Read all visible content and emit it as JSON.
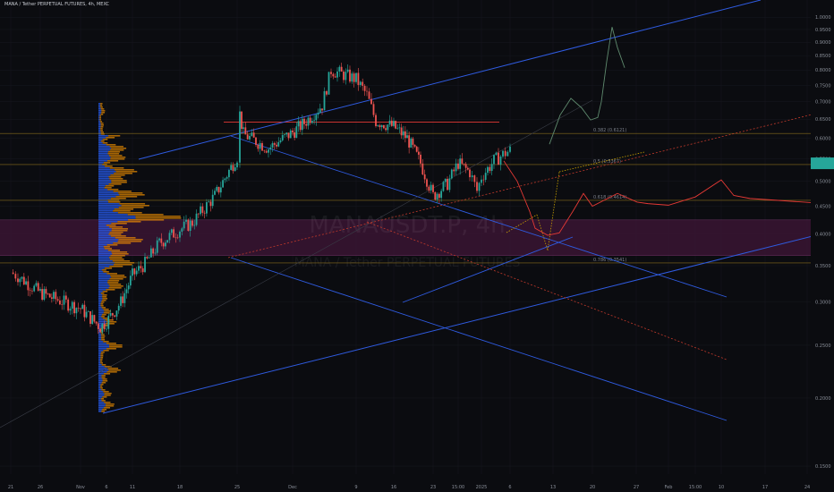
{
  "header": {
    "title": "MANA / Tether PERPETUAL FUTURES, 4h, MEXC"
  },
  "watermark": {
    "symbol": "MANAUSDT.P, 4h",
    "subtitle": "MANA / Tether PERPETUAL FUTURES"
  },
  "colors": {
    "background": "#0b0c10",
    "up": "#26a69a",
    "down": "#ef5350",
    "channel": "#2f5be0",
    "projection": "#e53935",
    "fib": "#9e7d1f",
    "zone": "#3a1533",
    "volume_up": "#2962ff",
    "volume_down": "#ff9800"
  },
  "chart_data": {
    "type": "candlestick",
    "timeframe": "4h",
    "y_axis": {
      "scale": "log",
      "range": [
        0.145,
        1.06
      ],
      "ticks": [
        "1.0000",
        "0.9500",
        "0.9000",
        "0.8500",
        "0.8000",
        "0.7500",
        "0.7000",
        "0.6500",
        "0.6000",
        "0.5500",
        "0.5000",
        "0.4500",
        "0.4000",
        "0.3500",
        "0.3000",
        "0.2500",
        "0.2000",
        "0.1500"
      ],
      "current_price_marker": 0.5385
    },
    "x_axis": {
      "ticks": [
        "21",
        "26",
        "Nov",
        "6",
        "11",
        "18",
        "25",
        "Dec",
        "9",
        "16",
        "23",
        "15:00",
        "2025",
        "6",
        "13",
        "20",
        "27",
        "Feb",
        "15:00",
        "10",
        "17",
        "24"
      ]
    },
    "fib_levels": [
      {
        "ratio": "0.382",
        "price": 0.6121,
        "label": "0.382 (0.6121)"
      },
      {
        "ratio": "0.5",
        "price": 0.5367,
        "label": "0.5 (0.5367)"
      },
      {
        "ratio": "0.618",
        "price": 0.4614,
        "label": "0.618 (0.4614)"
      },
      {
        "ratio": "0.786",
        "price": 0.3541,
        "label": "0.786 (0.3541)"
      }
    ],
    "horizontal_levels": [
      {
        "price": 0.642,
        "role": "resistance"
      }
    ],
    "demand_zone": [
      0.3655,
      0.4245
    ],
    "price_path": [
      [
        "21",
        0.34
      ],
      [
        "23",
        0.335
      ],
      [
        "26",
        0.312
      ],
      [
        "29",
        0.305
      ],
      [
        "Nov",
        0.292
      ],
      [
        "4",
        0.27
      ],
      [
        "6",
        0.276
      ],
      [
        "8",
        0.3
      ],
      [
        "11",
        0.336
      ],
      [
        "14",
        0.353
      ],
      [
        "16",
        0.385
      ],
      [
        "18",
        0.408
      ],
      [
        "20",
        0.42
      ],
      [
        "22",
        0.47
      ],
      [
        "25",
        0.555
      ],
      [
        "26",
        0.665
      ],
      [
        "27",
        0.61
      ],
      [
        "30",
        0.575
      ],
      [
        "Dec",
        0.615
      ],
      [
        "3",
        0.64
      ],
      [
        "5",
        0.69
      ],
      [
        "7",
        0.8
      ],
      [
        "9",
        0.77
      ],
      [
        "11",
        0.72
      ],
      [
        "12",
        0.645
      ],
      [
        "14",
        0.63
      ],
      [
        "16",
        0.6
      ],
      [
        "18",
        0.54
      ],
      [
        "20",
        0.47
      ],
      [
        "23",
        0.495
      ],
      [
        "15:00",
        0.54
      ],
      [
        "26",
        0.52
      ],
      [
        "28",
        0.48
      ],
      [
        "2025",
        0.51
      ],
      [
        "3",
        0.545
      ],
      [
        "5",
        0.56
      ],
      [
        "6",
        0.57
      ]
    ],
    "projection_path": [
      [
        "Jan 4",
        0.545
      ],
      [
        "Jan 7",
        0.5
      ],
      [
        "Jan 9",
        0.44
      ],
      [
        "Jan 10",
        0.41
      ],
      [
        "Jan 13",
        0.398
      ],
      [
        "Jan 17",
        0.402
      ],
      [
        "Jan 20",
        0.44
      ],
      [
        "Jan 22",
        0.475
      ],
      [
        "Jan 27",
        0.45
      ],
      [
        "Jan 30",
        0.475
      ],
      [
        "Feb 3",
        0.458
      ],
      [
        "Feb 6",
        0.455
      ],
      [
        "Feb 10",
        0.452
      ],
      [
        "Feb 14",
        0.468
      ],
      [
        "Feb 17",
        0.503
      ],
      [
        "Feb 19",
        0.471
      ],
      [
        "Feb 21",
        0.465
      ],
      [
        "Feb 24",
        0.457
      ]
    ],
    "alt_projection_path": [
      [
        "Jan 8",
        0.585
      ],
      [
        "Jan 10",
        0.662
      ],
      [
        "Jan 12",
        0.71
      ],
      [
        "Jan 14",
        0.682
      ],
      [
        "Jan 16",
        0.648
      ],
      [
        "Jan 18",
        0.655
      ],
      [
        "Jan 19",
        0.7
      ],
      [
        "Jan 21",
        0.83
      ],
      [
        "Jan 22",
        0.96
      ],
      [
        "Jan 23",
        0.88
      ],
      [
        "Jan 24",
        0.808
      ]
    ]
  }
}
